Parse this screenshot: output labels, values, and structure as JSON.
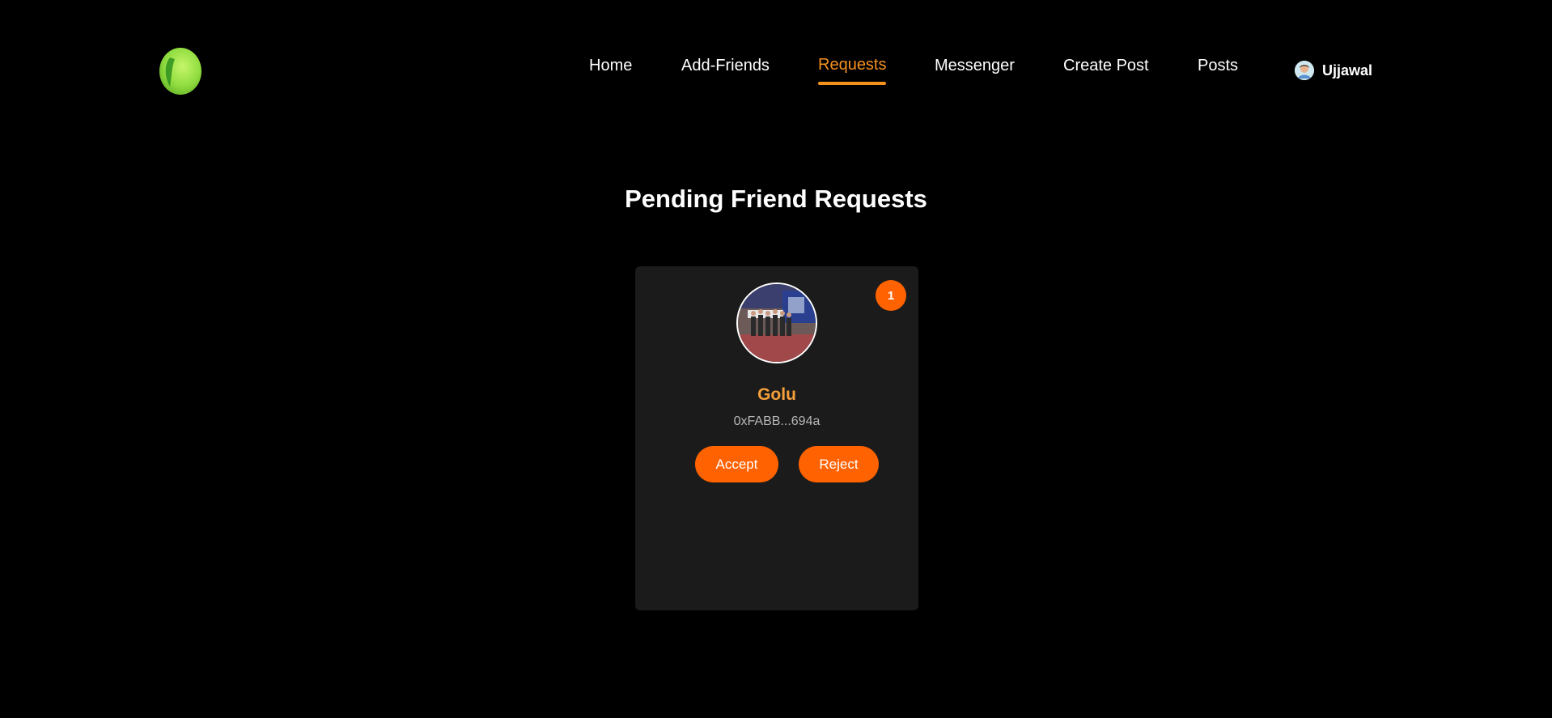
{
  "header": {
    "logo_icon": "green-apple-logo-icon",
    "nav": [
      {
        "label": "Home",
        "active": false
      },
      {
        "label": "Add-Friends",
        "active": false
      },
      {
        "label": "Requests",
        "active": true
      },
      {
        "label": "Messenger",
        "active": false
      },
      {
        "label": "Create Post",
        "active": false
      },
      {
        "label": "Posts",
        "active": false
      }
    ],
    "user": {
      "name": "Ujjawal",
      "avatar_icon": "user-avatar-icon"
    }
  },
  "main": {
    "title": "Pending Friend Requests",
    "requests": [
      {
        "badge": "1",
        "name": "Golu",
        "address": "0xFABB...694a",
        "avatar_icon": "group-photo-avatar",
        "accept_label": "Accept",
        "reject_label": "Reject"
      }
    ]
  },
  "colors": {
    "background": "#000000",
    "accent": "#f5911f",
    "button": "#ff6200",
    "card": "#1b1b1b",
    "name": "#f5a03a"
  }
}
